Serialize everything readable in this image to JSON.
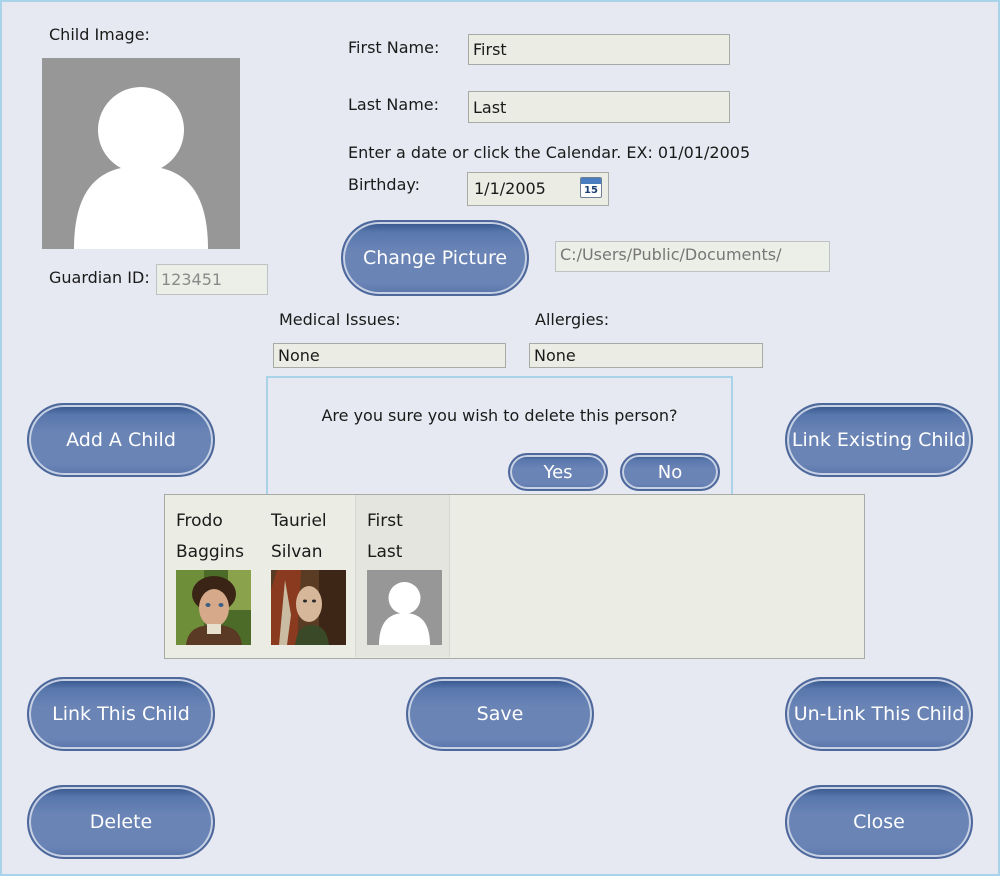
{
  "form": {
    "child_image_label": "Child Image:",
    "guardian_id_label": "Guardian ID:",
    "guardian_id_value": "123451",
    "first_name_label": "First Name:",
    "first_name_value": "First",
    "last_name_label": "Last Name:",
    "last_name_value": "Last",
    "date_hint": "Enter a date or click the Calendar. EX: 01/01/2005",
    "birthday_label": "Birthday:",
    "birthday_value": "1/1/2005",
    "calendar_day": "15",
    "picture_path": "C:/Users/Public/Documents/",
    "medical_label": "Medical Issues:",
    "medical_value": "None",
    "allergies_label": "Allergies:",
    "allergies_value": "None"
  },
  "buttons": {
    "change_picture": "Change Picture",
    "add_child": "Add A Child",
    "link_existing": "Link Existing Child",
    "link_this": "Link This Child",
    "save": "Save",
    "unlink": "Un-Link This Child",
    "delete": "Delete",
    "close": "Close"
  },
  "dialog": {
    "message": "Are you sure you wish to delete this person?",
    "yes": "Yes",
    "no": "No"
  },
  "children": [
    {
      "first": "Frodo",
      "last": "Baggins",
      "photo": "frodo-photo"
    },
    {
      "first": "Tauriel",
      "last": "Silvan",
      "photo": "tauriel-photo"
    },
    {
      "first": "First",
      "last": "Last",
      "photo": "default-avatar"
    }
  ],
  "colors": {
    "button": "#6a84b6",
    "background": "#e6e9f1",
    "field": "#ebece4",
    "frame_border": "#a9d3e8",
    "avatar_bg": "#979797"
  }
}
